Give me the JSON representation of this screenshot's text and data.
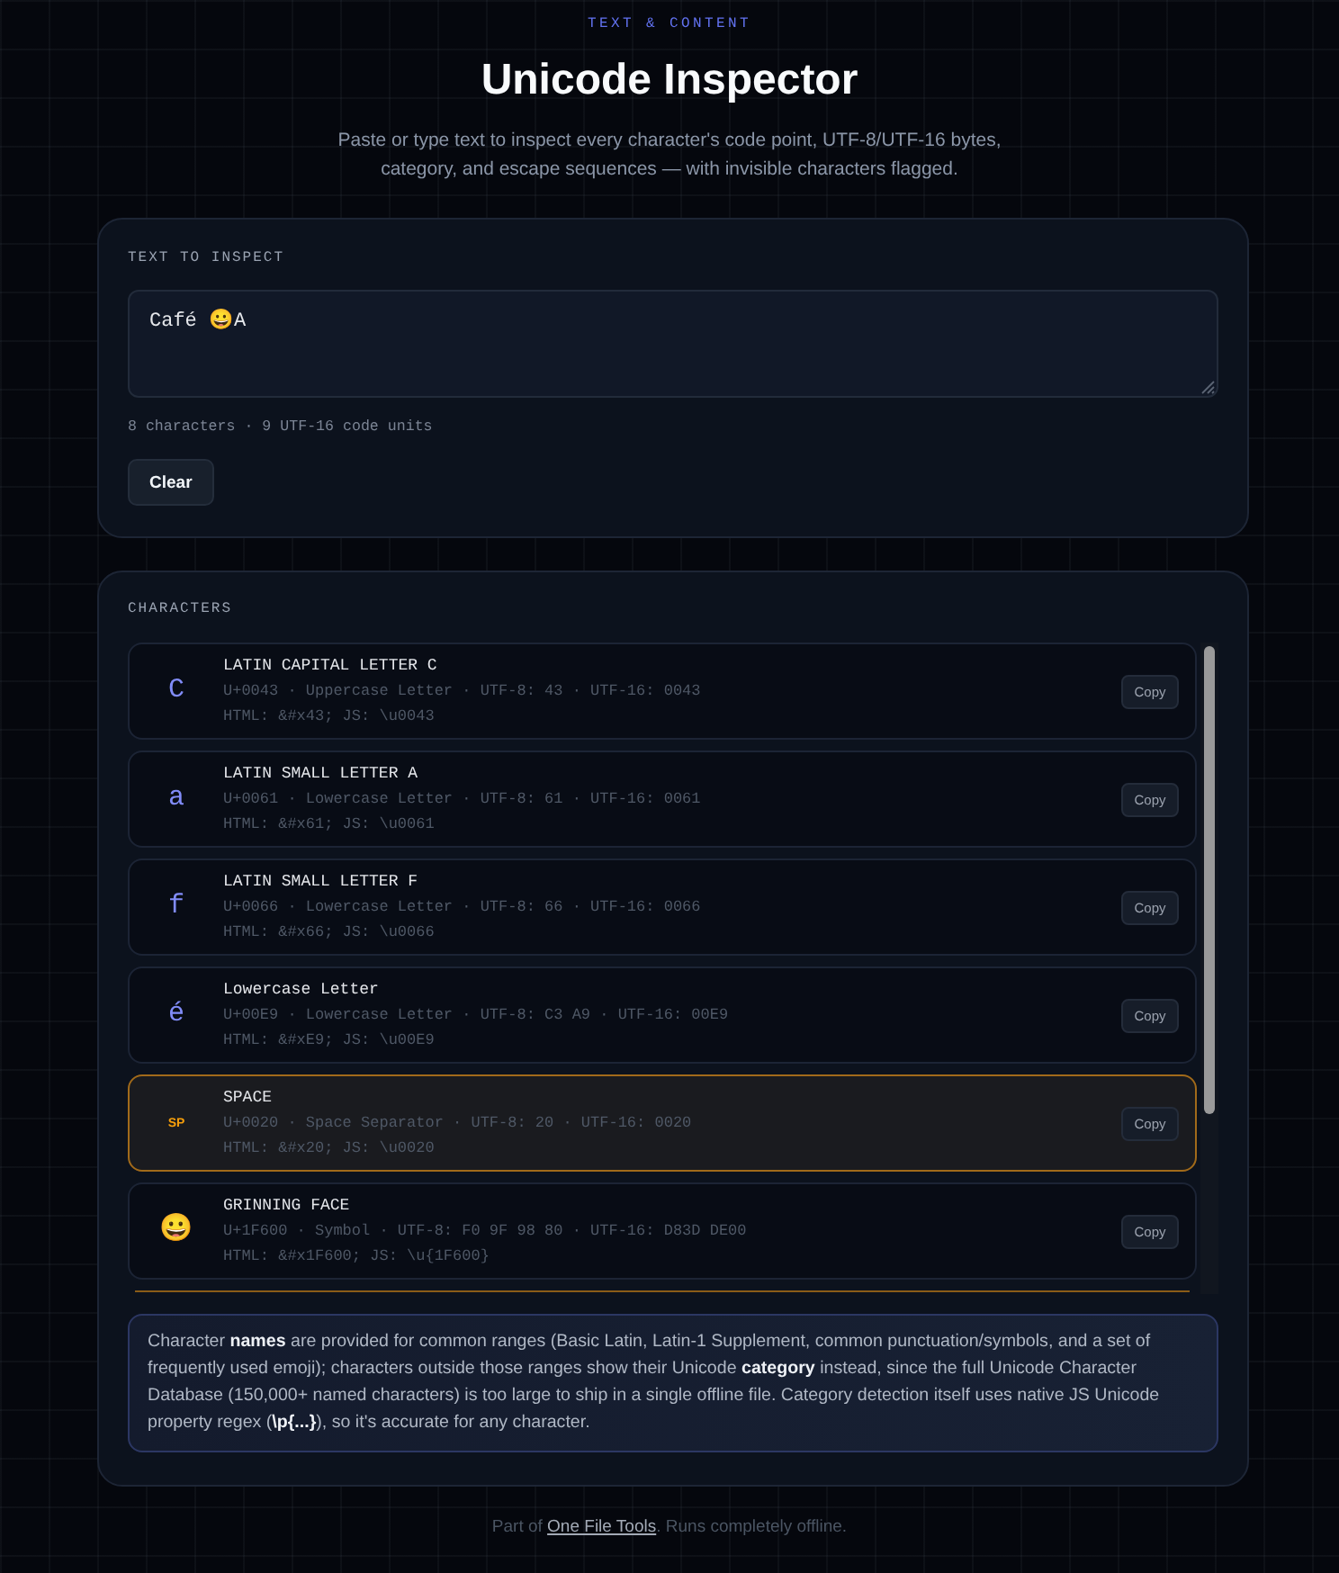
{
  "header": {
    "eyebrow": "TEXT & CONTENT",
    "title": "Unicode Inspector",
    "subtitle": "Paste or type text to inspect every character's code point, UTF-8/UTF-16 bytes, category, and escape sequences — with invisible characters flagged."
  },
  "input_card": {
    "label": "TEXT TO INSPECT",
    "value": "Café 😀A",
    "stats": "8 characters · 9 UTF-16 code units",
    "clear_button": "Clear"
  },
  "characters_card": {
    "label": "CHARACTERS",
    "rows": [
      {
        "kind": "char",
        "flagged": false,
        "glyph": "C",
        "name": "LATIN CAPITAL LETTER C",
        "details": "U+0043 · Uppercase Letter · UTF-8: 43 · UTF-16: 0043",
        "escapes": "HTML: &#x43; JS: \\u0043",
        "copy_button": "Copy"
      },
      {
        "kind": "char",
        "flagged": false,
        "glyph": "a",
        "name": "LATIN SMALL LETTER A",
        "details": "U+0061 · Lowercase Letter · UTF-8: 61 · UTF-16: 0061",
        "escapes": "HTML: &#x61; JS: \\u0061",
        "copy_button": "Copy"
      },
      {
        "kind": "char",
        "flagged": false,
        "glyph": "f",
        "name": "LATIN SMALL LETTER F",
        "details": "U+0066 · Lowercase Letter · UTF-8: 66 · UTF-16: 0066",
        "escapes": "HTML: &#x66; JS: \\u0066",
        "copy_button": "Copy"
      },
      {
        "kind": "char",
        "flagged": false,
        "glyph": "é",
        "name": "Lowercase Letter",
        "details": "U+00E9 · Lowercase Letter · UTF-8: C3 A9 · UTF-16: 00E9",
        "escapes": "HTML: &#xE9; JS: \\u00E9",
        "copy_button": "Copy"
      },
      {
        "kind": "abbrev",
        "flagged": true,
        "glyph": "SP",
        "name": "SPACE",
        "details": "U+0020 · Space Separator · UTF-8: 20 · UTF-16: 0020",
        "escapes": "HTML: &#x20; JS: \\u0020",
        "copy_button": "Copy"
      },
      {
        "kind": "emoji",
        "flagged": false,
        "glyph": "😀",
        "name": "GRINNING FACE",
        "details": "U+1F600 · Symbol · UTF-8: F0 9F 98 80 · UTF-16: D83D DE00",
        "escapes": "HTML: &#x1F600; JS: \\u{1F600}",
        "copy_button": "Copy"
      }
    ],
    "note": "Character **names** are provided for common ranges (Basic Latin, Latin-1 Supplement, common punctuation/symbols, and a set of frequently used emoji); characters outside those ranges show their Unicode **category** instead, since the full Unicode Character Database (150,000+ named characters) is too large to ship in a single offline file. Category detection itself uses native JS Unicode property regex (**\\p{...}**), so it's accurate for any character."
  },
  "footer": {
    "prefix": "Part of ",
    "link": "One File Tools",
    "suffix": ". Runs completely offline."
  }
}
